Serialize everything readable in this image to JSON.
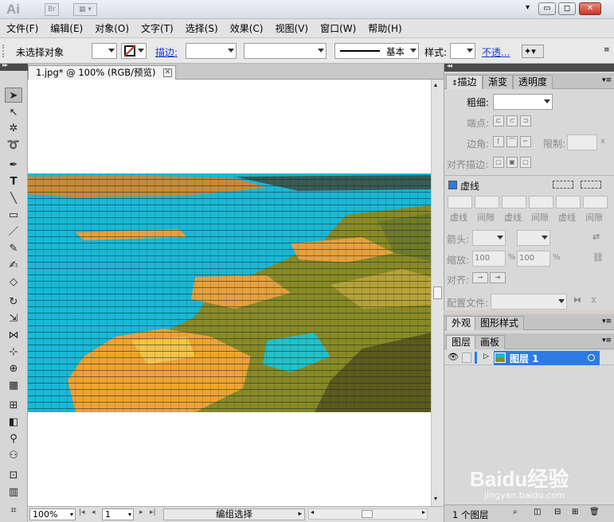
{
  "titlebar": {
    "logo": "Ai",
    "bridge_label": "Br",
    "window_buttons": [
      "▾",
      "▭",
      "✕"
    ],
    "close_label": "✕",
    "minimize_label": "▭",
    "maximize_label": "◻"
  },
  "menubar": {
    "items": [
      {
        "label": "文件(F)"
      },
      {
        "label": "编辑(E)"
      },
      {
        "label": "对象(O)"
      },
      {
        "label": "文字(T)"
      },
      {
        "label": "选择(S)"
      },
      {
        "label": "效果(C)"
      },
      {
        "label": "视图(V)"
      },
      {
        "label": "窗口(W)"
      },
      {
        "label": "帮助(H)"
      }
    ]
  },
  "controlbar": {
    "selection_status": "未选择对象",
    "stroke_label": "描边:",
    "stroke_style": "基本",
    "style_label": "样式:",
    "opacity_label": "不透..."
  },
  "document": {
    "tab_title": "1.jpg* @ 100% (RGB/预览)",
    "tab_close": "✕"
  },
  "statusbar": {
    "zoom": "100%",
    "artboard": "1",
    "mode": "编组选择"
  },
  "stroke_panel": {
    "tabs": [
      "描边",
      "渐变",
      "透明度"
    ],
    "weight_label": "粗细:",
    "cap_label": "端点:",
    "corner_label": "边角:",
    "limit_label": "限制:",
    "limit_unit": "x",
    "align_label": "对齐描边:",
    "dashed_label": "虚线",
    "dash_labels": [
      "虚线",
      "间隙",
      "虚线",
      "间隙",
      "虚线",
      "间隙"
    ],
    "arrow_label": "箭头:",
    "scale_label": "缩放:",
    "scale_values": [
      "100",
      "100"
    ],
    "scale_unit": "%",
    "align2_label": "对齐:",
    "profile_label": "配置文件:"
  },
  "appearance_panel": {
    "tabs": [
      "外观",
      "图形样式"
    ]
  },
  "layers_panel": {
    "tabs": [
      "图层",
      "画板"
    ],
    "layer_name": "图层 1",
    "footer_count": "1 个图层"
  },
  "watermark": {
    "brand": "Baidu经验",
    "url": "jingyan.baidu.com"
  },
  "colors": {
    "water": "#19b8d6",
    "sand": "#e8a03a",
    "vegetation": "#8a8a24",
    "layer_selection": "#2c7be5",
    "stroke_none": "#c0392b"
  }
}
